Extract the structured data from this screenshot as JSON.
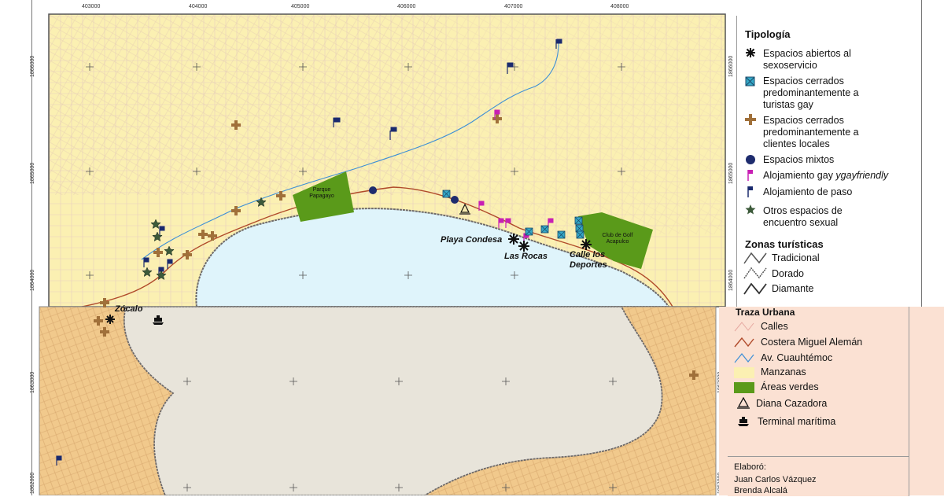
{
  "axis_ticks": {
    "top": [
      "403000",
      "404000",
      "405000",
      "406000",
      "407000",
      "408000"
    ],
    "left": [
      "1866000",
      "1865000",
      "1864000",
      "1863000",
      "1862000"
    ],
    "right": [
      "1866000",
      "1865000",
      "1864000",
      "1863000",
      "1862000"
    ]
  },
  "map_labels": {
    "parque": "Parque Papagayo",
    "club_golf": "Club de Golf Acapulco",
    "playa_condesa": "Playa Condesa",
    "las_rocas": "Las Rocas",
    "calle_deportes": "Calle los Deportes",
    "zocalo": "Zócalo"
  },
  "legend": {
    "tipologia_title": "Tipología",
    "tipologia": [
      {
        "icon": "asterisk-icon",
        "label": "Espacios abiertos al sexoservicio"
      },
      {
        "icon": "crossed-square-icon",
        "label": "Espacios cerrados predominantemente a turistas gay"
      },
      {
        "icon": "plus-icon",
        "label": "Espacios cerrados predominantemente a clientes locales"
      },
      {
        "icon": "circle-icon",
        "label": "Espacios mixtos"
      },
      {
        "icon": "magenta-flag-icon",
        "label": "Alojamiento gay ",
        "label_italic": "ygayfriendly"
      },
      {
        "icon": "navy-flag-icon",
        "label": "Alojamiento de paso"
      },
      {
        "icon": "star-icon",
        "label": "Otros espacios de encuentro sexual"
      }
    ],
    "zonas_title": "Zonas turísticas",
    "zonas": [
      "Tradicional",
      "Dorado",
      "Diamante"
    ],
    "traza_title": "Traza Urbana",
    "traza": [
      "Calles",
      "Costera Miguel Alemán",
      "Av. Cuauhtémoc",
      "Manzanas",
      "Áreas verdes",
      "Diana Cazadora",
      "Terminal marítima"
    ],
    "credits_title": "Elaboró:",
    "credits": [
      "Juan Carlos Vázquez",
      "Brenda Alcalá"
    ]
  },
  "colors": {
    "manzanas": "#fbf0b2",
    "water_top": "#dff4fb",
    "green": "#5a9a1a",
    "cuauhtemoc": "#3d8fd6",
    "costera": "#b04a2a",
    "bottom_bg": "#fbe1d3",
    "bottom_land": "#f1c98c",
    "bottom_water": "#e8e4da",
    "plus": "#a0703a",
    "crossed_square": "#35a9c8",
    "mixed": "#1e2c6e",
    "magenta_flag": "#c81fb4",
    "navy_flag": "#1a2a6e",
    "star": "#3c5a3a"
  }
}
